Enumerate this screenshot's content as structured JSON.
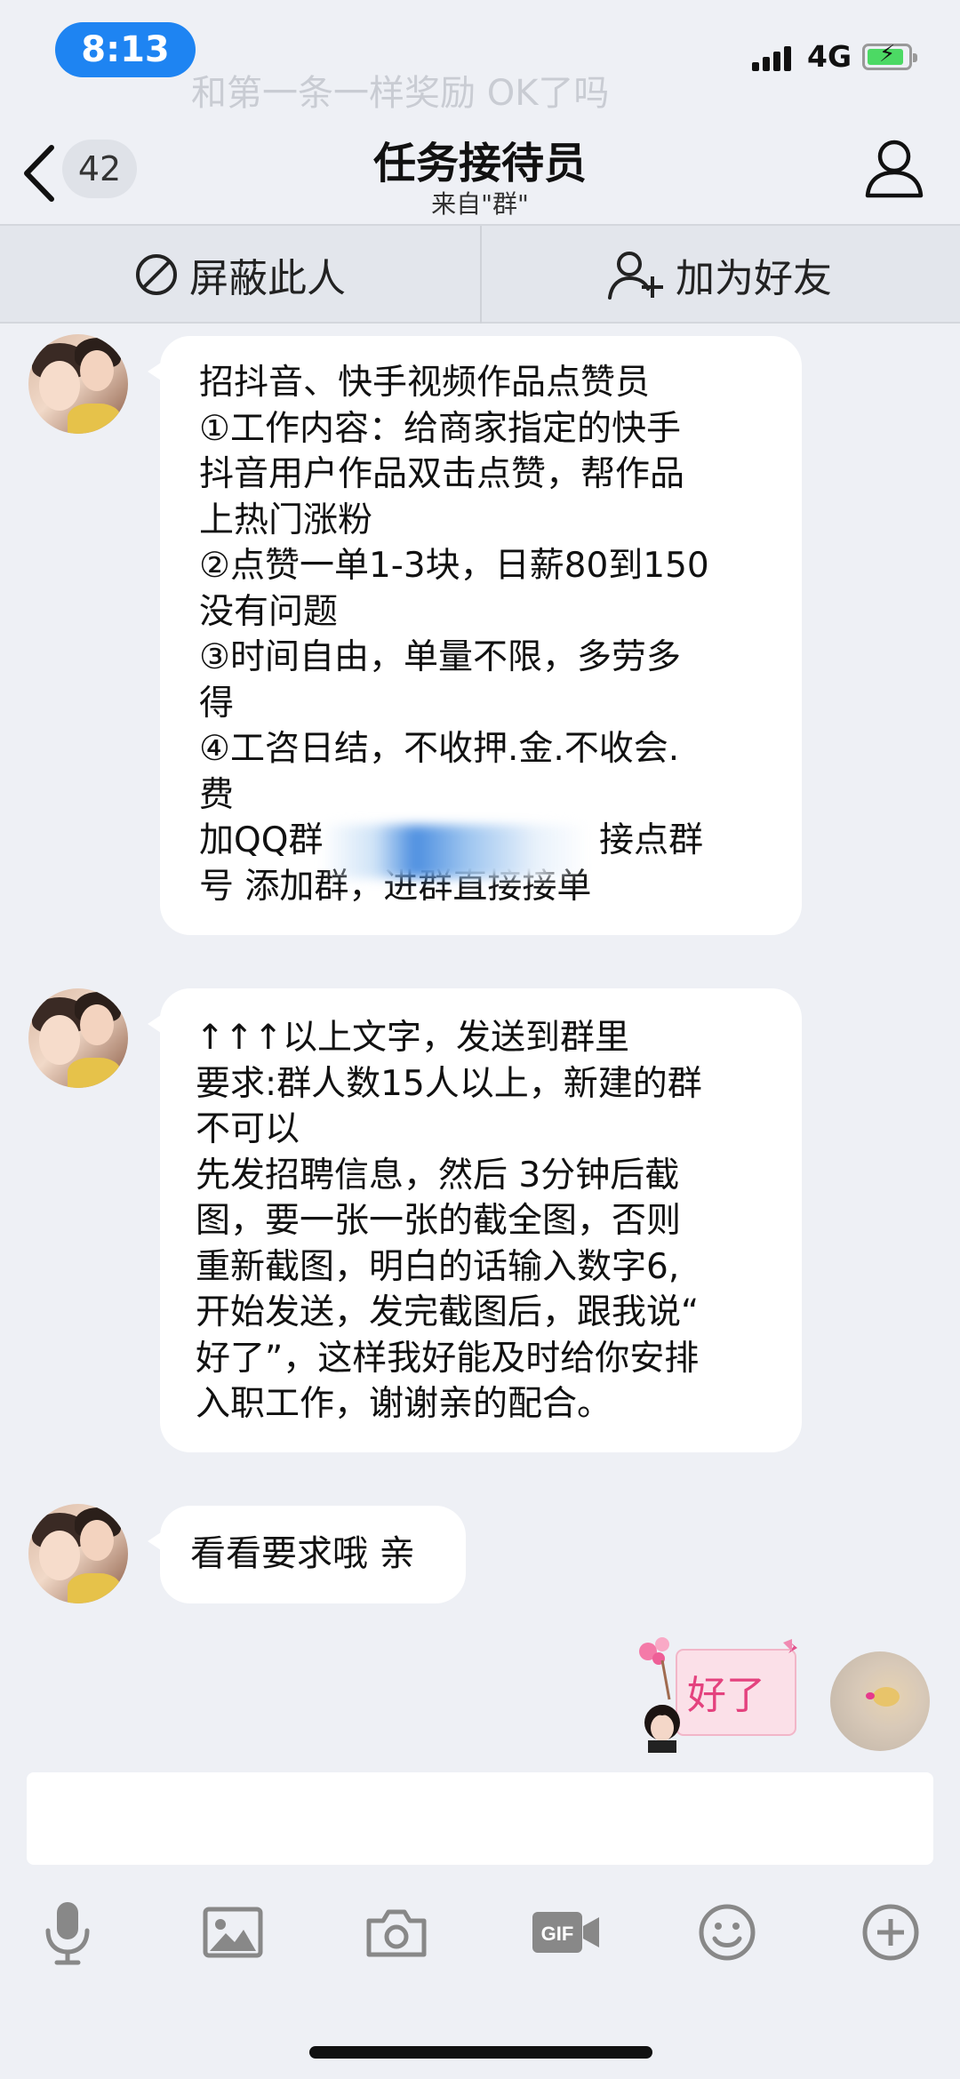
{
  "status_bar": {
    "time": "8:13",
    "ghost_text": "和第一条一样奖励 OK了吗",
    "network": "4G"
  },
  "header": {
    "unread_count": "42",
    "title": "任务接待员",
    "subtitle": "来自\"群\""
  },
  "actions": {
    "block_label": "屏蔽此人",
    "add_friend_label": "加为好友"
  },
  "messages": [
    {
      "lines": [
        "招抖音、快手视频作品点赞员",
        "①工作内容：给商家指定的快手",
        "抖音用户作品双击点赞，帮作品",
        "上热门涨粉",
        "②点赞一单1-3块，日薪80到150",
        "没有问题",
        "③时间自由，单量不限，多劳多",
        "得",
        "④工咨日结，不收押.金.不收会.",
        "费",
        "加QQ群",
        "接点群",
        "号 添加群，进群直接接单"
      ]
    },
    {
      "lines": [
        "↑↑↑以上文字，发送到群里",
        "要求:群人数15人以上，新建的群",
        "不可以",
        "先发招聘信息，然后 3分钟后截",
        "图，要一张一张的截全图，否则",
        "重新截图，明白的话输入数字6,",
        "开始发送，发完截图后，跟我说“",
        "好了”，这样我好能及时给你安排",
        "入职工作，谢谢亲的配合。"
      ]
    },
    {
      "lines": [
        "看看要求哦 亲"
      ]
    }
  ],
  "sticker": {
    "text": "好了"
  },
  "colors": {
    "accent": "#1e84f2",
    "background": "#eef0f5",
    "bubble": "#ffffff",
    "battery": "#4cd964"
  },
  "toolbar_icons": [
    "microphone-icon",
    "image-icon",
    "camera-icon",
    "gif-icon",
    "emoji-icon",
    "plus-icon"
  ]
}
